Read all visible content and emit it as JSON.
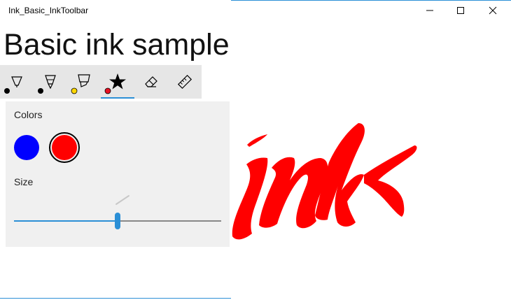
{
  "window": {
    "title": "Ink_Basic_InkToolbar",
    "controls": [
      "minimize-icon",
      "maximize-icon",
      "close-icon"
    ]
  },
  "page": {
    "heading": "Basic ink sample"
  },
  "toolbar": {
    "tools": [
      {
        "name": "ballpoint-pen",
        "icon": "ballpoint-pen-icon",
        "color": "#000000",
        "selected": false
      },
      {
        "name": "pencil",
        "icon": "pencil-icon",
        "color": "#000000",
        "selected": false
      },
      {
        "name": "highlighter",
        "icon": "highlighter-icon",
        "color": "#ffd700",
        "selected": false
      },
      {
        "name": "custom-pen",
        "icon": "star-icon",
        "color": "#e81123",
        "selected": true
      },
      {
        "name": "eraser",
        "icon": "eraser-icon",
        "selected": false
      },
      {
        "name": "ruler",
        "icon": "ruler-icon",
        "selected": false
      }
    ]
  },
  "flyout": {
    "colors_label": "Colors",
    "colors": [
      {
        "name": "blue",
        "hex": "#0000ff",
        "selected": false
      },
      {
        "name": "red",
        "hex": "#ff0000",
        "selected": true
      }
    ],
    "size_label": "Size",
    "size_value": 0.5
  },
  "canvas": {
    "stroke_color": "#ff0000",
    "handwritten_text": "ink"
  }
}
